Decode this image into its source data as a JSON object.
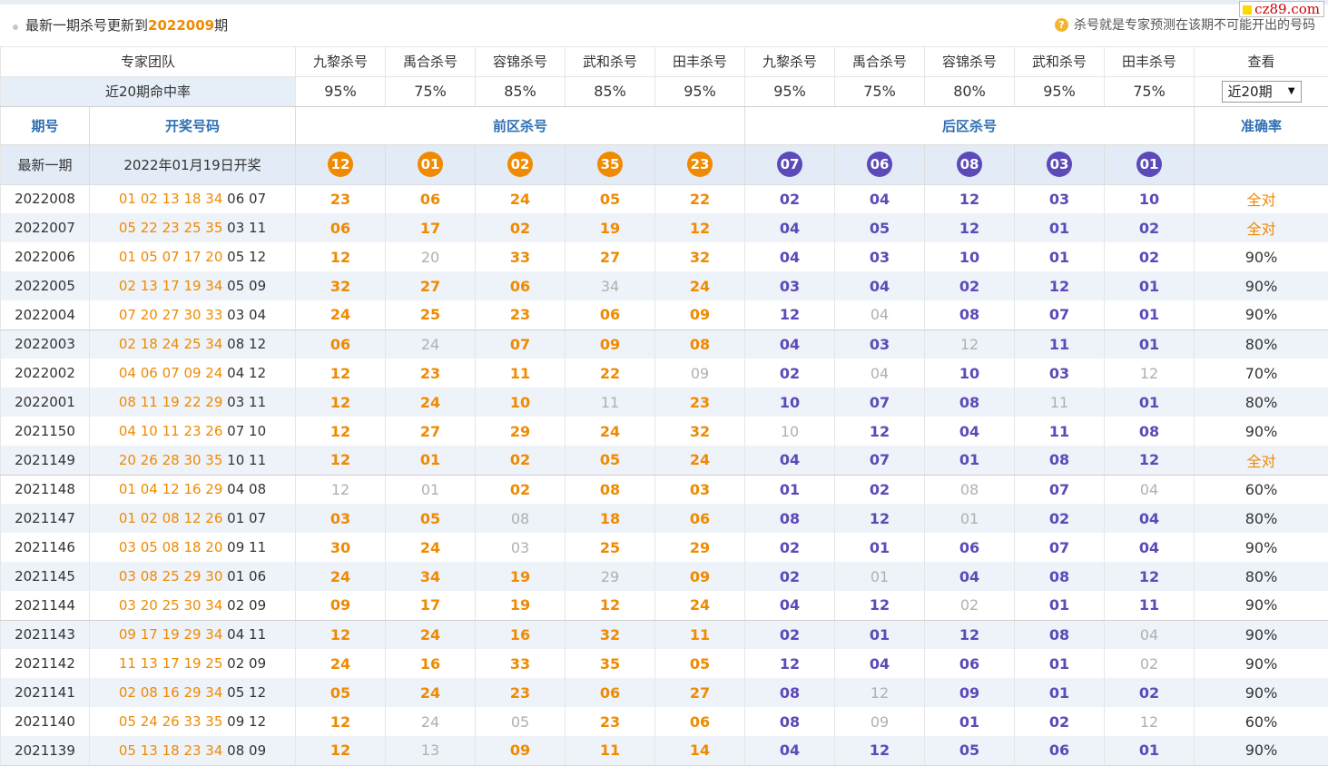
{
  "header": {
    "title_prefix": "最新一期杀号更新到",
    "issue": "2022009",
    "title_suffix": "期",
    "note": "杀号就是专家预测在该期不可能开出的号码",
    "note_icon": "question-icon",
    "watermark": "cz89.com"
  },
  "team_row": {
    "label": "专家团队",
    "experts": [
      "九黎杀号",
      "禹合杀号",
      "容锦杀号",
      "武和杀号",
      "田丰杀号",
      "九黎杀号",
      "禹合杀号",
      "容锦杀号",
      "武和杀号",
      "田丰杀号"
    ],
    "view_label": "查看"
  },
  "rate_row": {
    "label": "近20期命中率",
    "rates": [
      "95%",
      "75%",
      "85%",
      "85%",
      "95%",
      "95%",
      "75%",
      "80%",
      "95%",
      "75%"
    ],
    "select_value": "近20期"
  },
  "section_row": {
    "period": "期号",
    "draw": "开奖号码",
    "front": "前区杀号",
    "back": "后区杀号",
    "accuracy": "准确率"
  },
  "latest": {
    "label": "最新一期",
    "draw_date": "2022年01月19日开奖",
    "front": [
      "12",
      "01",
      "02",
      "35",
      "23"
    ],
    "back": [
      "07",
      "06",
      "08",
      "03",
      "01"
    ]
  },
  "colors": {
    "front": "#f08a00",
    "back": "#5b4ab8",
    "miss": "#b0b0b0",
    "header_blue": "#2f6fb3"
  },
  "rows": [
    {
      "period": "2022008",
      "front_draw": "01 02 13 18 34",
      "back_draw": "06 07",
      "kills": [
        [
          "23",
          "h"
        ],
        [
          "06",
          "h"
        ],
        [
          "24",
          "h"
        ],
        [
          "05",
          "h"
        ],
        [
          "22",
          "h"
        ],
        [
          "02",
          "h"
        ],
        [
          "04",
          "h"
        ],
        [
          "12",
          "h"
        ],
        [
          "03",
          "h"
        ],
        [
          "10",
          "h"
        ]
      ],
      "accuracy": "全对"
    },
    {
      "period": "2022007",
      "front_draw": "05 22 23 25 35",
      "back_draw": "03 11",
      "kills": [
        [
          "06",
          "h"
        ],
        [
          "17",
          "h"
        ],
        [
          "02",
          "h"
        ],
        [
          "19",
          "h"
        ],
        [
          "12",
          "h"
        ],
        [
          "04",
          "h"
        ],
        [
          "05",
          "h"
        ],
        [
          "12",
          "h"
        ],
        [
          "01",
          "h"
        ],
        [
          "02",
          "h"
        ]
      ],
      "accuracy": "全对"
    },
    {
      "period": "2022006",
      "front_draw": "01 05 07 17 20",
      "back_draw": "05 12",
      "kills": [
        [
          "12",
          "h"
        ],
        [
          "20",
          "m"
        ],
        [
          "33",
          "h"
        ],
        [
          "27",
          "h"
        ],
        [
          "32",
          "h"
        ],
        [
          "04",
          "h"
        ],
        [
          "03",
          "h"
        ],
        [
          "10",
          "h"
        ],
        [
          "01",
          "h"
        ],
        [
          "02",
          "h"
        ]
      ],
      "accuracy": "90%"
    },
    {
      "period": "2022005",
      "front_draw": "02 13 17 19 34",
      "back_draw": "05 09",
      "kills": [
        [
          "32",
          "h"
        ],
        [
          "27",
          "h"
        ],
        [
          "06",
          "h"
        ],
        [
          "34",
          "m"
        ],
        [
          "24",
          "h"
        ],
        [
          "03",
          "h"
        ],
        [
          "04",
          "h"
        ],
        [
          "02",
          "h"
        ],
        [
          "12",
          "h"
        ],
        [
          "01",
          "h"
        ]
      ],
      "accuracy": "90%"
    },
    {
      "period": "2022004",
      "front_draw": "07 20 27 30 33",
      "back_draw": "03 04",
      "kills": [
        [
          "24",
          "h"
        ],
        [
          "25",
          "h"
        ],
        [
          "23",
          "h"
        ],
        [
          "06",
          "h"
        ],
        [
          "09",
          "h"
        ],
        [
          "12",
          "h"
        ],
        [
          "04",
          "m"
        ],
        [
          "08",
          "h"
        ],
        [
          "07",
          "h"
        ],
        [
          "01",
          "h"
        ]
      ],
      "accuracy": "90%"
    },
    {
      "period": "2022003",
      "front_draw": "02 18 24 25 34",
      "back_draw": "08 12",
      "kills": [
        [
          "06",
          "h"
        ],
        [
          "24",
          "m"
        ],
        [
          "07",
          "h"
        ],
        [
          "09",
          "h"
        ],
        [
          "08",
          "h"
        ],
        [
          "04",
          "h"
        ],
        [
          "03",
          "h"
        ],
        [
          "12",
          "m"
        ],
        [
          "11",
          "h"
        ],
        [
          "01",
          "h"
        ]
      ],
      "accuracy": "80%"
    },
    {
      "period": "2022002",
      "front_draw": "04 06 07 09 24",
      "back_draw": "04 12",
      "kills": [
        [
          "12",
          "h"
        ],
        [
          "23",
          "h"
        ],
        [
          "11",
          "h"
        ],
        [
          "22",
          "h"
        ],
        [
          "09",
          "m"
        ],
        [
          "02",
          "h"
        ],
        [
          "04",
          "m"
        ],
        [
          "10",
          "h"
        ],
        [
          "03",
          "h"
        ],
        [
          "12",
          "m"
        ]
      ],
      "accuracy": "70%"
    },
    {
      "period": "2022001",
      "front_draw": "08 11 19 22 29",
      "back_draw": "03 11",
      "kills": [
        [
          "12",
          "h"
        ],
        [
          "24",
          "h"
        ],
        [
          "10",
          "h"
        ],
        [
          "11",
          "m"
        ],
        [
          "23",
          "h"
        ],
        [
          "10",
          "h"
        ],
        [
          "07",
          "h"
        ],
        [
          "08",
          "h"
        ],
        [
          "11",
          "m"
        ],
        [
          "01",
          "h"
        ]
      ],
      "accuracy": "80%"
    },
    {
      "period": "2021150",
      "front_draw": "04 10 11 23 26",
      "back_draw": "07 10",
      "kills": [
        [
          "12",
          "h"
        ],
        [
          "27",
          "h"
        ],
        [
          "29",
          "h"
        ],
        [
          "24",
          "h"
        ],
        [
          "32",
          "h"
        ],
        [
          "10",
          "m"
        ],
        [
          "12",
          "h"
        ],
        [
          "04",
          "h"
        ],
        [
          "11",
          "h"
        ],
        [
          "08",
          "h"
        ]
      ],
      "accuracy": "90%"
    },
    {
      "period": "2021149",
      "front_draw": "20 26 28 30 35",
      "back_draw": "10 11",
      "kills": [
        [
          "12",
          "h"
        ],
        [
          "01",
          "h"
        ],
        [
          "02",
          "h"
        ],
        [
          "05",
          "h"
        ],
        [
          "24",
          "h"
        ],
        [
          "04",
          "h"
        ],
        [
          "07",
          "h"
        ],
        [
          "01",
          "h"
        ],
        [
          "08",
          "h"
        ],
        [
          "12",
          "h"
        ]
      ],
      "accuracy": "全对"
    },
    {
      "period": "2021148",
      "front_draw": "01 04 12 16 29",
      "back_draw": "04 08",
      "kills": [
        [
          "12",
          "m"
        ],
        [
          "01",
          "m"
        ],
        [
          "02",
          "h"
        ],
        [
          "08",
          "h"
        ],
        [
          "03",
          "h"
        ],
        [
          "01",
          "h"
        ],
        [
          "02",
          "h"
        ],
        [
          "08",
          "m"
        ],
        [
          "07",
          "h"
        ],
        [
          "04",
          "m"
        ]
      ],
      "accuracy": "60%"
    },
    {
      "period": "2021147",
      "front_draw": "01 02 08 12 26",
      "back_draw": "01 07",
      "kills": [
        [
          "03",
          "h"
        ],
        [
          "05",
          "h"
        ],
        [
          "08",
          "m"
        ],
        [
          "18",
          "h"
        ],
        [
          "06",
          "h"
        ],
        [
          "08",
          "h"
        ],
        [
          "12",
          "h"
        ],
        [
          "01",
          "m"
        ],
        [
          "02",
          "h"
        ],
        [
          "04",
          "h"
        ]
      ],
      "accuracy": "80%"
    },
    {
      "period": "2021146",
      "front_draw": "03 05 08 18 20",
      "back_draw": "09 11",
      "kills": [
        [
          "30",
          "h"
        ],
        [
          "24",
          "h"
        ],
        [
          "03",
          "m"
        ],
        [
          "25",
          "h"
        ],
        [
          "29",
          "h"
        ],
        [
          "02",
          "h"
        ],
        [
          "01",
          "h"
        ],
        [
          "06",
          "h"
        ],
        [
          "07",
          "h"
        ],
        [
          "04",
          "h"
        ]
      ],
      "accuracy": "90%"
    },
    {
      "period": "2021145",
      "front_draw": "03 08 25 29 30",
      "back_draw": "01 06",
      "kills": [
        [
          "24",
          "h"
        ],
        [
          "34",
          "h"
        ],
        [
          "19",
          "h"
        ],
        [
          "29",
          "m"
        ],
        [
          "09",
          "h"
        ],
        [
          "02",
          "h"
        ],
        [
          "01",
          "m"
        ],
        [
          "04",
          "h"
        ],
        [
          "08",
          "h"
        ],
        [
          "12",
          "h"
        ]
      ],
      "accuracy": "80%"
    },
    {
      "period": "2021144",
      "front_draw": "03 20 25 30 34",
      "back_draw": "02 09",
      "kills": [
        [
          "09",
          "h"
        ],
        [
          "17",
          "h"
        ],
        [
          "19",
          "h"
        ],
        [
          "12",
          "h"
        ],
        [
          "24",
          "h"
        ],
        [
          "04",
          "h"
        ],
        [
          "12",
          "h"
        ],
        [
          "02",
          "m"
        ],
        [
          "01",
          "h"
        ],
        [
          "11",
          "h"
        ]
      ],
      "accuracy": "90%"
    },
    {
      "period": "2021143",
      "front_draw": "09 17 19 29 34",
      "back_draw": "04 11",
      "kills": [
        [
          "12",
          "h"
        ],
        [
          "24",
          "h"
        ],
        [
          "16",
          "h"
        ],
        [
          "32",
          "h"
        ],
        [
          "11",
          "h"
        ],
        [
          "02",
          "h"
        ],
        [
          "01",
          "h"
        ],
        [
          "12",
          "h"
        ],
        [
          "08",
          "h"
        ],
        [
          "04",
          "m"
        ]
      ],
      "accuracy": "90%"
    },
    {
      "period": "2021142",
      "front_draw": "11 13 17 19 25",
      "back_draw": "02 09",
      "kills": [
        [
          "24",
          "h"
        ],
        [
          "16",
          "h"
        ],
        [
          "33",
          "h"
        ],
        [
          "35",
          "h"
        ],
        [
          "05",
          "h"
        ],
        [
          "12",
          "h"
        ],
        [
          "04",
          "h"
        ],
        [
          "06",
          "h"
        ],
        [
          "01",
          "h"
        ],
        [
          "02",
          "m"
        ]
      ],
      "accuracy": "90%"
    },
    {
      "period": "2021141",
      "front_draw": "02 08 16 29 34",
      "back_draw": "05 12",
      "kills": [
        [
          "05",
          "h"
        ],
        [
          "24",
          "h"
        ],
        [
          "23",
          "h"
        ],
        [
          "06",
          "h"
        ],
        [
          "27",
          "h"
        ],
        [
          "08",
          "h"
        ],
        [
          "12",
          "m"
        ],
        [
          "09",
          "h"
        ],
        [
          "01",
          "h"
        ],
        [
          "02",
          "h"
        ]
      ],
      "accuracy": "90%"
    },
    {
      "period": "2021140",
      "front_draw": "05 24 26 33 35",
      "back_draw": "09 12",
      "kills": [
        [
          "12",
          "h"
        ],
        [
          "24",
          "m"
        ],
        [
          "05",
          "m"
        ],
        [
          "23",
          "h"
        ],
        [
          "06",
          "h"
        ],
        [
          "08",
          "h"
        ],
        [
          "09",
          "m"
        ],
        [
          "01",
          "h"
        ],
        [
          "02",
          "h"
        ],
        [
          "12",
          "m"
        ]
      ],
      "accuracy": "60%"
    },
    {
      "period": "2021139",
      "front_draw": "05 13 18 23 34",
      "back_draw": "08 09",
      "kills": [
        [
          "12",
          "h"
        ],
        [
          "13",
          "m"
        ],
        [
          "09",
          "h"
        ],
        [
          "11",
          "h"
        ],
        [
          "14",
          "h"
        ],
        [
          "04",
          "h"
        ],
        [
          "12",
          "h"
        ],
        [
          "05",
          "h"
        ],
        [
          "06",
          "h"
        ],
        [
          "01",
          "h"
        ]
      ],
      "accuracy": "90%"
    }
  ]
}
